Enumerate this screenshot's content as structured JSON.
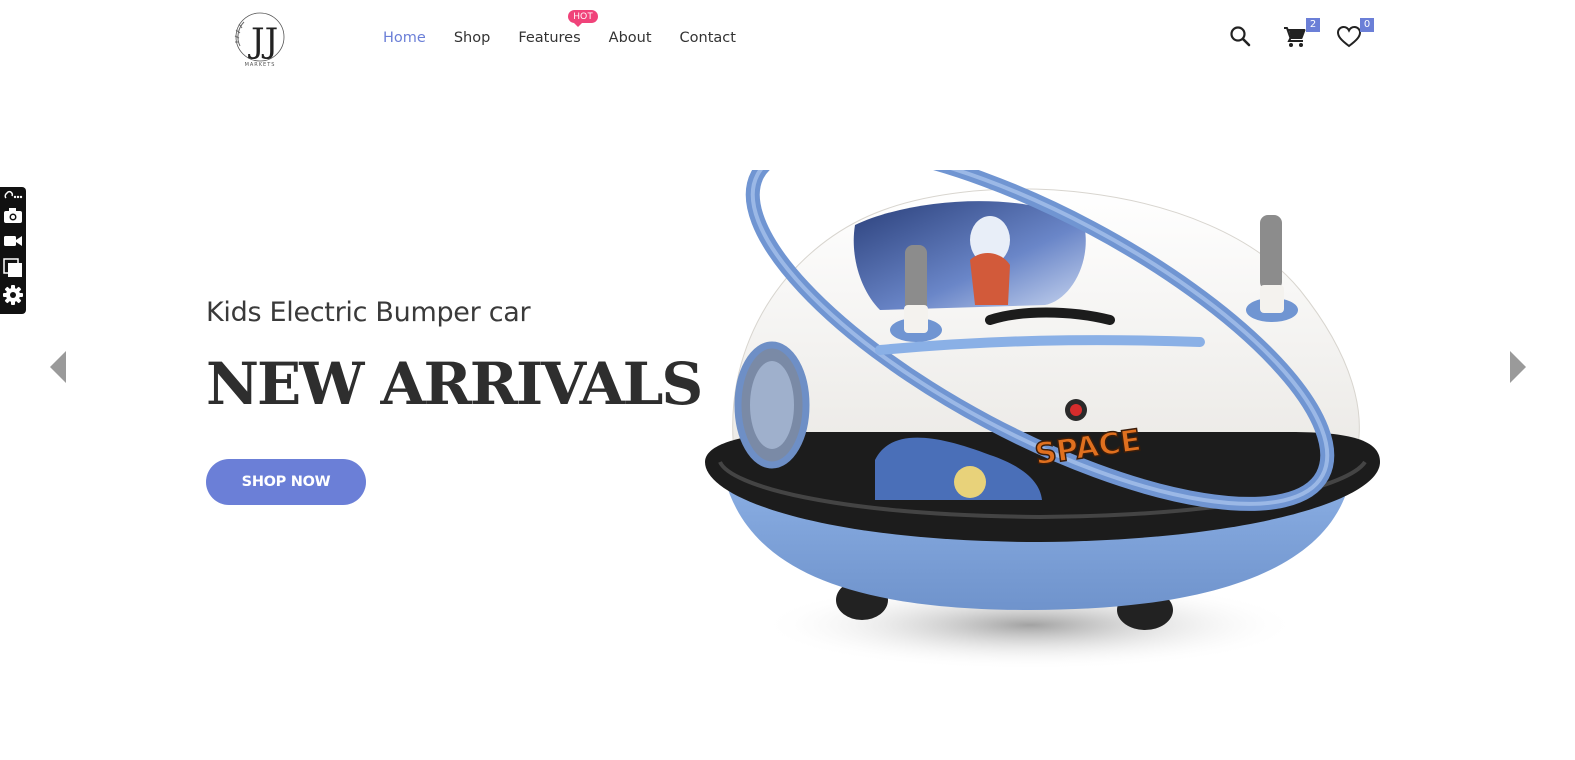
{
  "header": {
    "logo_text": "JJ",
    "logo_subtext": "MARKETS",
    "nav": [
      {
        "label": "Home",
        "active": true
      },
      {
        "label": "Shop"
      },
      {
        "label": "Features",
        "badge": "HOT"
      },
      {
        "label": "About"
      },
      {
        "label": "Contact"
      }
    ],
    "icons": {
      "search": "search-icon",
      "cart": "cart-icon",
      "wishlist": "heart-icon"
    },
    "cart_count": "2",
    "wishlist_count": "0"
  },
  "side_toolbar": [
    "link-more-icon",
    "camera-icon",
    "video-icon",
    "layers-icon",
    "gear-icon"
  ],
  "hero": {
    "subtitle": "Kids Electric Bumper car",
    "title": "NEW ARRIVALS",
    "button_label": "SHOP NOW",
    "image_alt": "Kids electric bumper car, white and blue with space astronaut decals",
    "decal_text": "SPACE"
  },
  "colors": {
    "accent": "#6b7fd7",
    "badge": "#f0437a",
    "text": "#333333"
  }
}
